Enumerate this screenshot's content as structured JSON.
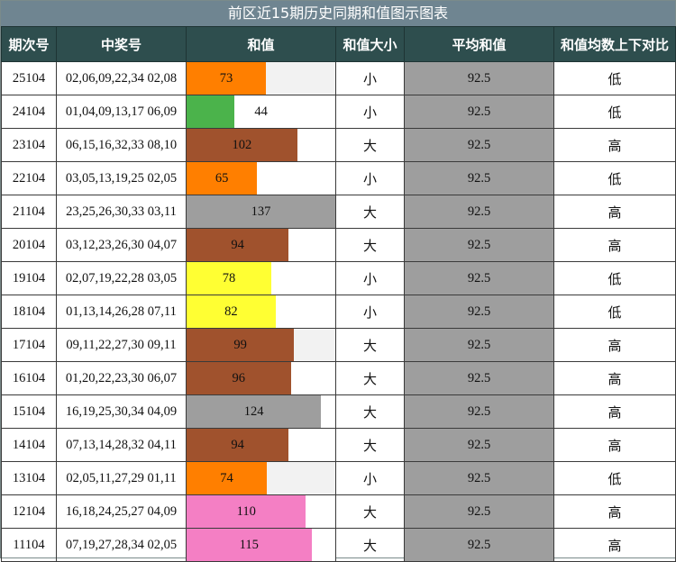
{
  "title": "前区近15期历史同期和值图示图表",
  "headers": [
    "期次号",
    "中奖号",
    "和值",
    "和值大小",
    "平均和值",
    "和值均数上下对比"
  ],
  "sum_max": 137,
  "colors": {
    "orange": "#ff7f00",
    "green": "#4bb34b",
    "brown": "#a0522d",
    "gray": "#9e9e9e",
    "yellow": "#ffff33",
    "pink": "#f47fc4",
    "header_bg": "#2e4e4e",
    "title_bg": "#6f8591"
  },
  "rows": [
    {
      "period": "25104",
      "numbers": "02,06,09,22,34 02,08",
      "sum": "73",
      "size": "小",
      "avg": "92.5",
      "trend": "低",
      "color": "orange",
      "track": true
    },
    {
      "period": "24104",
      "numbers": "01,04,09,13,17 06,09",
      "sum": "44",
      "size": "小",
      "avg": "92.5",
      "trend": "低",
      "color": "green",
      "track": false
    },
    {
      "period": "23104",
      "numbers": "06,15,16,32,33 08,10",
      "sum": "102",
      "size": "大",
      "avg": "92.5",
      "trend": "高",
      "color": "brown",
      "track": false
    },
    {
      "period": "22104",
      "numbers": "03,05,13,19,25 02,05",
      "sum": "65",
      "size": "小",
      "avg": "92.5",
      "trend": "低",
      "color": "orange",
      "track": false
    },
    {
      "period": "21104",
      "numbers": "23,25,26,30,33 03,11",
      "sum": "137",
      "size": "大",
      "avg": "92.5",
      "trend": "高",
      "color": "gray",
      "track": false
    },
    {
      "period": "20104",
      "numbers": "03,12,23,26,30 04,07",
      "sum": "94",
      "size": "大",
      "avg": "92.5",
      "trend": "高",
      "color": "brown",
      "track": false
    },
    {
      "period": "19104",
      "numbers": "02,07,19,22,28 03,05",
      "sum": "78",
      "size": "小",
      "avg": "92.5",
      "trend": "低",
      "color": "yellow",
      "track": false
    },
    {
      "period": "18104",
      "numbers": "01,13,14,26,28 07,11",
      "sum": "82",
      "size": "小",
      "avg": "92.5",
      "trend": "低",
      "color": "yellow",
      "track": false
    },
    {
      "period": "17104",
      "numbers": "09,11,22,27,30 09,11",
      "sum": "99",
      "size": "大",
      "avg": "92.5",
      "trend": "高",
      "color": "brown",
      "track": true
    },
    {
      "period": "16104",
      "numbers": "01,20,22,23,30 06,07",
      "sum": "96",
      "size": "大",
      "avg": "92.5",
      "trend": "高",
      "color": "brown",
      "track": false
    },
    {
      "period": "15104",
      "numbers": "16,19,25,30,34 04,09",
      "sum": "124",
      "size": "大",
      "avg": "92.5",
      "trend": "高",
      "color": "gray",
      "track": false
    },
    {
      "period": "14104",
      "numbers": "07,13,14,28,32 04,11",
      "sum": "94",
      "size": "大",
      "avg": "92.5",
      "trend": "高",
      "color": "brown",
      "track": false
    },
    {
      "period": "13104",
      "numbers": "02,05,11,27,29 01,11",
      "sum": "74",
      "size": "小",
      "avg": "92.5",
      "trend": "低",
      "color": "orange",
      "track": true
    },
    {
      "period": "12104",
      "numbers": "16,18,24,25,27 04,09",
      "sum": "110",
      "size": "大",
      "avg": "92.5",
      "trend": "高",
      "color": "pink",
      "track": false
    },
    {
      "period": "11104",
      "numbers": "07,19,27,28,34 02,05",
      "sum": "115",
      "size": "大",
      "avg": "92.5",
      "trend": "高",
      "color": "pink",
      "track": false
    }
  ]
}
